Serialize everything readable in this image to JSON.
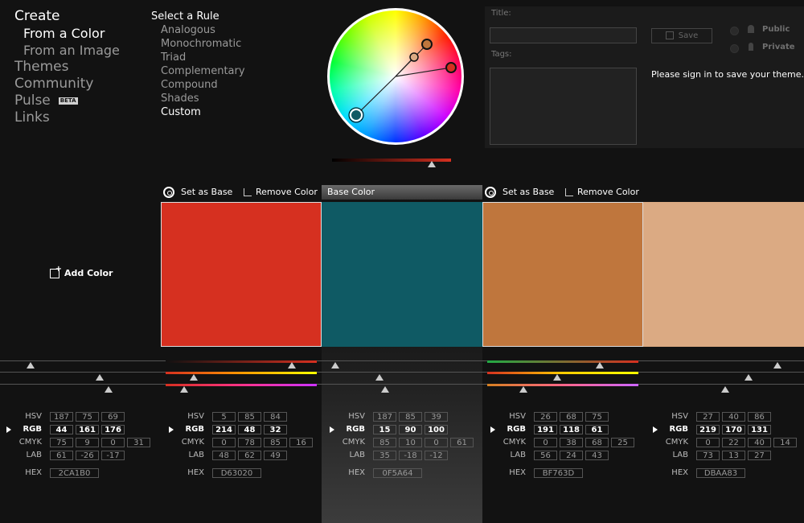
{
  "nav": {
    "create": "Create",
    "from_color": "From a Color",
    "from_image": "From an Image",
    "themes": "Themes",
    "community": "Community",
    "pulse": "Pulse",
    "beta": "BETA",
    "links": "Links"
  },
  "rules": {
    "heading": "Select a Rule",
    "items": [
      "Analogous",
      "Monochromatic",
      "Triad",
      "Complementary",
      "Compound",
      "Shades",
      "Custom"
    ],
    "active": "Custom"
  },
  "panel": {
    "title_label": "Title:",
    "tags_label": "Tags:",
    "save": "Save",
    "public": "Public",
    "private": "Private",
    "signin": "Please sign in to save your theme."
  },
  "actions": {
    "set_base": "Set as Base",
    "remove": "Remove Color",
    "base_color": "Base Color",
    "add_color": "Add Color"
  },
  "labels": {
    "hsv": "HSV",
    "rgb": "RGB",
    "cmyk": "CMYK",
    "lab": "LAB",
    "hex": "HEX"
  },
  "swatches": [
    {
      "color": "#2CA1B0",
      "hsv": [
        "187",
        "75",
        "69"
      ],
      "rgb": [
        "44",
        "161",
        "176"
      ],
      "cmyk": [
        "75",
        "9",
        "0",
        "31"
      ],
      "lab": [
        "61",
        "-26",
        "-17"
      ],
      "hex": "2CA1B0"
    },
    {
      "color": "#D63020",
      "hsv": [
        "5",
        "85",
        "84"
      ],
      "rgb": [
        "214",
        "48",
        "32"
      ],
      "cmyk": [
        "0",
        "78",
        "85",
        "16"
      ],
      "lab": [
        "48",
        "62",
        "49"
      ],
      "hex": "D63020"
    },
    {
      "color": "#0F5A64",
      "hsv": [
        "187",
        "85",
        "39"
      ],
      "rgb": [
        "15",
        "90",
        "100"
      ],
      "cmyk": [
        "85",
        "10",
        "0",
        "61"
      ],
      "lab": [
        "35",
        "-18",
        "-12"
      ],
      "hex": "0F5A64"
    },
    {
      "color": "#BF763D",
      "hsv": [
        "26",
        "68",
        "75"
      ],
      "rgb": [
        "191",
        "118",
        "61"
      ],
      "cmyk": [
        "0",
        "38",
        "68",
        "25"
      ],
      "lab": [
        "56",
        "24",
        "43"
      ],
      "hex": "BF763D"
    },
    {
      "color": "#DBAA83",
      "hsv": [
        "27",
        "40",
        "86"
      ],
      "rgb": [
        "219",
        "170",
        "131"
      ],
      "cmyk": [
        "0",
        "22",
        "40",
        "14"
      ],
      "lab": [
        "73",
        "13",
        "27"
      ],
      "hex": "DBAA83"
    }
  ],
  "colors": {
    "background": "#121212",
    "panel": "#1b1b1b"
  }
}
